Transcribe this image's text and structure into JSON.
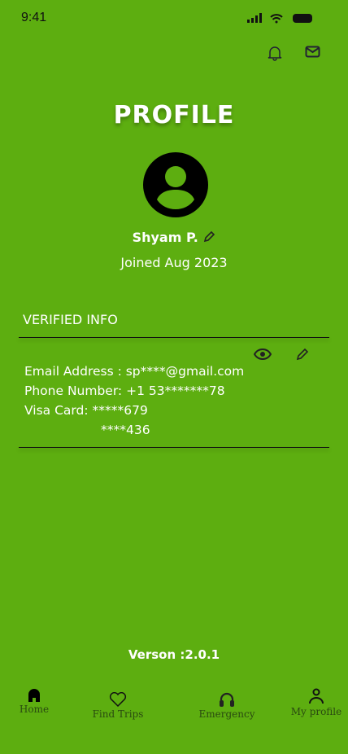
{
  "status_bar": {
    "time": "9:41"
  },
  "header": {
    "title": "PROFILE"
  },
  "profile": {
    "name": "Shyam P.",
    "joined": "Joined Aug 2023"
  },
  "verified": {
    "heading": "VERIFIED INFO",
    "email": "Email Address : sp****@gmail.com",
    "phone": "Phone Number: +1 53*******78",
    "visa": "Visa Card: *****679",
    "visa2": "****436"
  },
  "version": "Verson :2.0.1",
  "nav": [
    {
      "label": "Home"
    },
    {
      "label": "Find Trips"
    },
    {
      "label": "Emergency"
    },
    {
      "label": "My profile"
    }
  ]
}
